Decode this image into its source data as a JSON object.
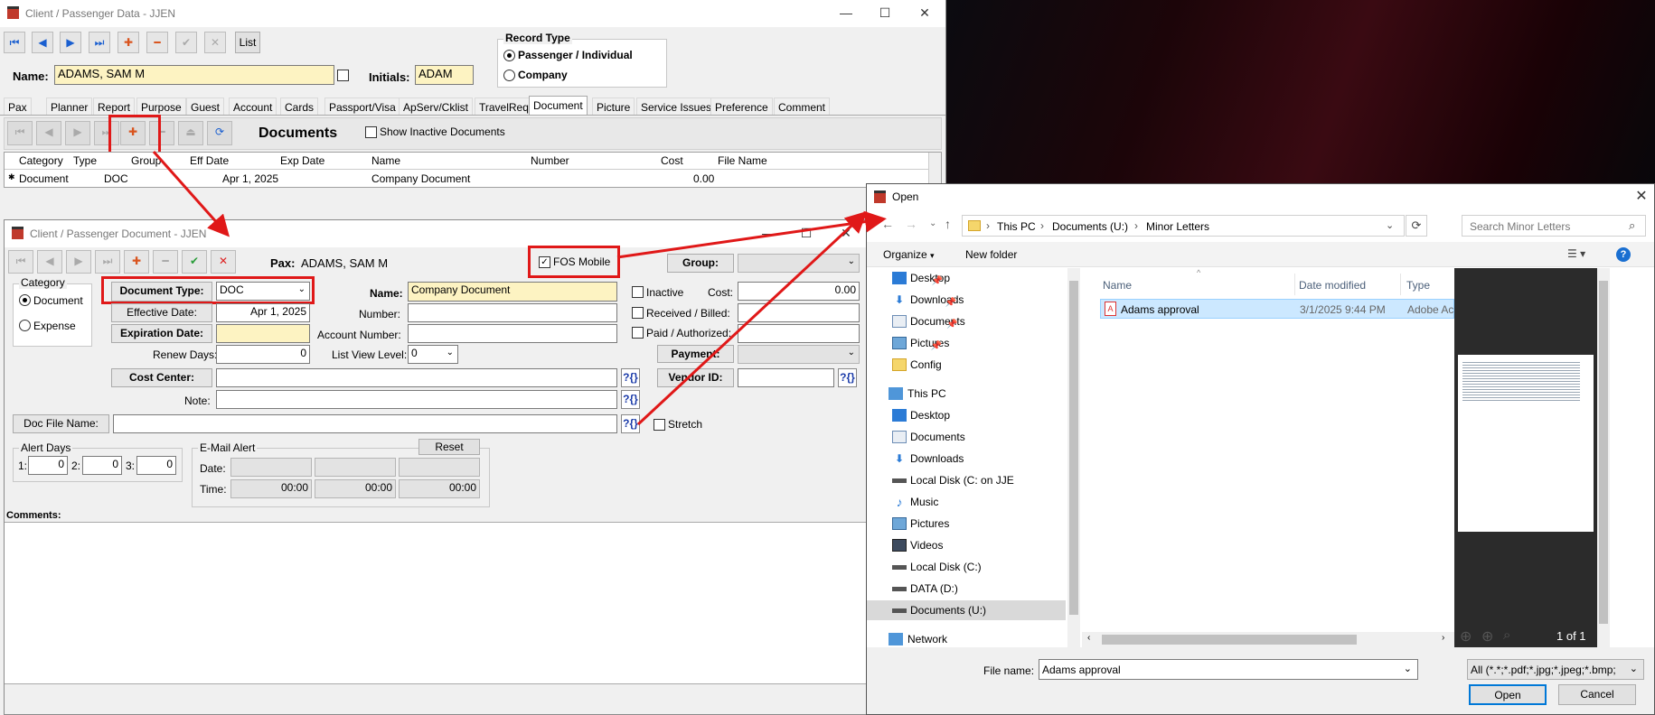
{
  "main_window": {
    "title": "Client / Passenger Data - JJEN",
    "toolbar": {
      "list_label": "List"
    },
    "record_type": {
      "label": "Record Type",
      "options": [
        "Passenger / Individual",
        "Company"
      ],
      "selected": "Passenger / Individual"
    },
    "name_label": "Name:",
    "name_value": "ADAMS, SAM M",
    "initials_label": "Initials:",
    "initials_value": "ADAM",
    "tabs": [
      "Pax",
      "Planner",
      "Report",
      "Purpose",
      "Guest",
      "Account",
      "Cards",
      "Passport/Visa",
      "ApServ/Cklist",
      "TravelReq",
      "Document",
      "Picture",
      "Service Issues",
      "Preference",
      "Comment"
    ],
    "active_tab": "Document",
    "documents_title": "Documents",
    "show_inactive_label": "Show Inactive Documents",
    "grid": {
      "columns": [
        "Category",
        "Type",
        "Group",
        "Eff Date",
        "Exp Date",
        "Name",
        "Number",
        "Cost",
        "File Name"
      ],
      "rows": [
        {
          "category": "Document",
          "type": "DOC",
          "group": "",
          "eff_date": "Apr 1, 2025",
          "exp_date": "",
          "name": "Company Document",
          "number": "",
          "cost": "0.00",
          "file_name": ""
        }
      ]
    }
  },
  "doc_window": {
    "title": "Client / Passenger Document - JJEN",
    "pax_label": "Pax:",
    "pax_value": "ADAMS, SAM M",
    "fos_mobile_label": "FOS Mobile",
    "fos_mobile_checked": true,
    "group_label": "Group:",
    "category_label": "Category",
    "category_options": [
      "Document",
      "Expense"
    ],
    "category_selected": "Document",
    "document_type_label": "Document Type:",
    "document_type_value": "DOC",
    "effective_date_label": "Effective Date:",
    "effective_date_value": "Apr 1, 2025",
    "expiration_date_label": "Expiration Date:",
    "renew_days_label": "Renew Days:",
    "renew_days_value": "0",
    "name_label": "Name:",
    "name_value": "Company Document",
    "number_label": "Number:",
    "account_number_label": "Account Number:",
    "list_view_level_label": "List View Level:",
    "list_view_level_value": "0",
    "inactive_label": "Inactive",
    "received_billed_label": "Received  / Billed:",
    "paid_authorized_label": "Paid / Authorized:",
    "cost_label": "Cost:",
    "cost_value": "0.00",
    "payment_label": "Payment:",
    "cost_center_label": "Cost Center:",
    "vendor_id_label": "Vendor ID:",
    "note_label": "Note:",
    "doc_file_name_label": "Doc File Name:",
    "stretch_label": "Stretch",
    "alert_days_label": "Alert Days",
    "alert_days": [
      {
        "label": "1:",
        "value": "0"
      },
      {
        "label": "2:",
        "value": "0"
      },
      {
        "label": "3:",
        "value": "0"
      }
    ],
    "email_alert_label": "E-Mail Alert",
    "reset_label": "Reset",
    "date_label": "Date:",
    "time_label": "Time:",
    "times": [
      "00:00",
      "00:00",
      "00:00"
    ],
    "comments_label": "Comments:",
    "qbtn_label": "?{}"
  },
  "open_dialog": {
    "title": "Open",
    "breadcrumb": [
      "This PC",
      "Documents (U:)",
      "Minor Letters"
    ],
    "search_placeholder": "Search Minor Letters",
    "organize_label": "Organize",
    "new_folder_label": "New folder",
    "nav_items": [
      {
        "label": "Desktop",
        "icon": "desktop-icon",
        "pinned": true
      },
      {
        "label": "Downloads",
        "icon": "download-icon",
        "pinned": true
      },
      {
        "label": "Documents",
        "icon": "documents-icon",
        "pinned": true
      },
      {
        "label": "Pictures",
        "icon": "pictures-icon",
        "pinned": true
      },
      {
        "label": "Config",
        "icon": "folder-icon",
        "pinned": false
      }
    ],
    "this_pc_label": "This PC",
    "this_pc_items": [
      {
        "label": "Desktop",
        "icon": "desktop-icon"
      },
      {
        "label": "Documents",
        "icon": "documents-icon"
      },
      {
        "label": "Downloads",
        "icon": "download-icon"
      },
      {
        "label": "Local Disk (C: on JJE",
        "icon": "drive-icon"
      },
      {
        "label": "Music",
        "icon": "music-icon"
      },
      {
        "label": "Pictures",
        "icon": "pictures-icon"
      },
      {
        "label": "Videos",
        "icon": "videos-icon"
      },
      {
        "label": "Local Disk (C:)",
        "icon": "drive-icon"
      },
      {
        "label": "DATA (D:)",
        "icon": "drive-icon"
      },
      {
        "label": "Documents (U:)",
        "icon": "drive-icon"
      }
    ],
    "network_label": "Network",
    "columns": [
      "Name",
      "Date modified",
      "Type"
    ],
    "files": [
      {
        "name": "Adams approval",
        "date_modified": "3/1/2025 9:44 PM",
        "type": "Adobe Ac"
      }
    ],
    "preview_page": "1 of 1",
    "file_name_label": "File name:",
    "file_name_value": "Adams approval",
    "filter_value": "All (*.*;*.pdf;*.jpg;*.jpeg;*.bmp;",
    "open_label": "Open",
    "cancel_label": "Cancel"
  },
  "colors": {
    "highlight_red": "#e01818",
    "field_yellow": "#fdf3c2",
    "selection_blue": "#cce8ff"
  }
}
